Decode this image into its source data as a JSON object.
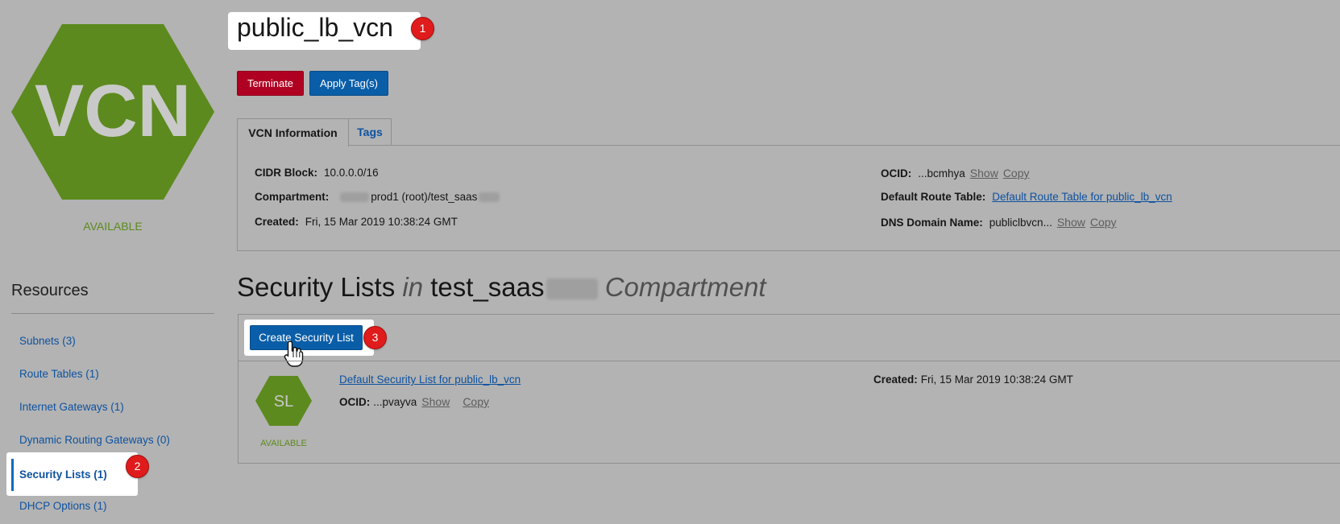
{
  "resource": {
    "badge_text": "VCN",
    "status": "AVAILABLE",
    "name": "public_lb_vcn"
  },
  "callouts": [
    "1",
    "2",
    "3"
  ],
  "actions": {
    "terminate": "Terminate",
    "apply_tags": "Apply Tag(s)"
  },
  "tabs": [
    {
      "label": "VCN Information",
      "active": true
    },
    {
      "label": "Tags",
      "active": false
    }
  ],
  "info": {
    "cidr_label": "CIDR Block:",
    "cidr_value": "10.0.0.0/16",
    "compartment_label": "Compartment:",
    "compartment_value": "prod1 (root)/test_saas",
    "created_label": "Created:",
    "created_value": "Fri, 15 Mar 2019 10:38:24 GMT",
    "ocid_label": "OCID:",
    "ocid_value": "...bcmhya",
    "show": "Show",
    "copy": "Copy",
    "route_label": "Default Route Table:",
    "route_value": "Default Route Table for public_lb_vcn",
    "dns_label": "DNS Domain Name:",
    "dns_value": "publiclbvcn..."
  },
  "sidebar": {
    "title": "Resources",
    "items": [
      {
        "label": "Subnets (3)"
      },
      {
        "label": "Route Tables (1)"
      },
      {
        "label": "Internet Gateways (1)"
      },
      {
        "label": "Dynamic Routing Gateways (0)"
      },
      {
        "label": "Security Lists (1)"
      },
      {
        "label": "DHCP Options (1)"
      }
    ]
  },
  "section": {
    "title_prefix": "Security Lists",
    "title_in": "in",
    "title_compartment": "test_saas",
    "title_suffix": "Compartment"
  },
  "security_list": {
    "create_button": "Create Security List",
    "item": {
      "badge": "SL",
      "status": "AVAILABLE",
      "name": "Default Security List for public_lb_vcn",
      "ocid_label": "OCID:",
      "ocid_value": "...pvayva",
      "show": "Show",
      "copy": "Copy",
      "created_label": "Created:",
      "created_value": "Fri, 15 Mar 2019 10:38:24 GMT"
    }
  },
  "colors": {
    "background": "#b3b3b3",
    "hex_green": "#5c8a1e",
    "terminate_red": "#b00022",
    "primary_blue": "#0a5ea8",
    "link_blue": "#0e52a0",
    "callout_red": "#e01b1b"
  }
}
